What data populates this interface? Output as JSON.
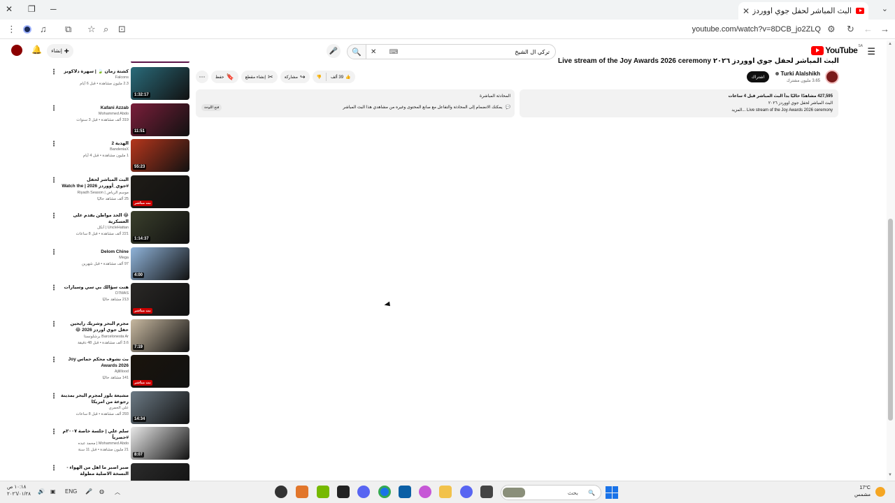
{
  "browser": {
    "tab_title": "البث المباشر لحفل جوي اووردز ٢٠٢٦",
    "url": "youtube.com/watch?v=8DCB_jo2ZLQ",
    "new_tab": "+",
    "tab_close": "✕"
  },
  "youtube": {
    "logo_word": "YouTube",
    "logo_region": "SA",
    "search_value": "تركي ال الشيخ",
    "create_label": "إنشاء"
  },
  "video": {
    "title": "البث المباشر لحفل جوي اووردز ٢٠٢٦ Live stream of the Joy Awards 2026 ceremony",
    "channel": "Turki Alalshikh",
    "subscribers": "3.65 مليون مشترك",
    "subscribe_label": "اشتراك",
    "likes": "39 ألف",
    "share_label": "مشاركة",
    "clip_label": "إنشاء مقطع",
    "save_label": "حفظ",
    "description_stats": "427,595 مشاهدًا حاليًا  بدأ البث المباشر قبل 4 ساعات",
    "description_line1": "البث المباشر لحفل جوي اووردز ٢٠٢٦",
    "description_line2": "Live stream of the Joy Awards 2026 ceremony ...المزيد",
    "chat_title": "المحادثة المباشرة",
    "chat_message": "يمكنك الانضمام إلى المحادثة والتفاعل مع صانع المحتوى وغيره من مشاهدي هذا البث المباشر",
    "chat_open": "فتح اللوحة"
  },
  "recommendations": [
    {
      "title": "كشتة زمان 🍃 | سهرة دلاكوبز",
      "channel": "Falcons",
      "views": "2.3 مليون مشاهدة • قبل 6 أيام",
      "badge": "1:32:17",
      "live": false,
      "color": "#2a6b7a"
    },
    {
      "title": "Kafani Azzab",
      "channel": "Mohammed Abdo",
      "views": "319 ألف مشاهدة • قبل 3 سنوات",
      "badge": "11:51",
      "live": false,
      "color": "#7a1e3a"
    },
    {
      "title": "الهدية 2",
      "channel": "BandeniaX",
      "views": "1 مليون مشاهدة • قبل 4 أيام",
      "badge": "55:23",
      "live": false,
      "color": "#b5361c"
    },
    {
      "title": "البث المباشر لحفل #جوي_أووردز 2026 | Watch the Live Stream of Joy ...",
      "channel": "موسم الرياض | Riyadh Season",
      "views": "25 ألف مشاهد حاليًا",
      "badge": "بث مباشر",
      "live": true,
      "color": "#1f1c17"
    },
    {
      "title": "😂 الحد مواطن يقدم على العسكرية",
      "channel": "UncleHattan | أنكل",
      "views": "221 ألف مشاهدة • قبل 8 ساعات",
      "badge": "1:14:37",
      "live": false,
      "color": "#3a3f2c"
    },
    {
      "title": "Delom Chine",
      "channel": "Mega",
      "views": "97 ألف مشاهدة • قبل شهرين",
      "badge": "4:00",
      "live": false,
      "color": "#8fb3d9"
    },
    {
      "title": "هنت سؤالك بي سي وسيارات",
      "channel": "D7MAS",
      "views": "213 مشاهد حاليًا",
      "badge": "بث مباشر",
      "live": true,
      "color": "#2a2826"
    },
    {
      "title": "مجرم البحر وشريك رايحين حفل جوي اوردز 2026 😂 متوترين",
      "channel": "Barcelonesta Ar برشلونستا",
      "views": "3.6 ألف مشاهدة • قبل 48 دقيقة",
      "badge": "7:19",
      "live": false,
      "color": "#c7b8a0"
    },
    {
      "title": "بث نشوف محكم حماس Joy Awards 2026",
      "channel": "Ajlilllood",
      "views": "141 مشاهد حاليًا",
      "badge": "بث مباشر",
      "live": true,
      "color": "#1a140c"
    },
    {
      "title": "مشيعة بلوز لمجرم البحر بمدينة رجوعة من امريكا",
      "channel": "علي الحمري",
      "views": "293 ألف مشاهدة • قبل 8 ساعات",
      "badge": "14:34",
      "live": false,
      "color": "#6c7a85"
    },
    {
      "title": "سلم علي | جلسة خاصة ٢٠٠٧م #حصرياً",
      "channel": "Mohammed Abdo | محمد عبده",
      "views": "21 مليون مشاهدة • قبل 11 سنة",
      "badge": "8:07",
      "live": false,
      "color": "#e8e8e8"
    },
    {
      "title": "صبر اصبر ما اهل من الهواء - النسخة الاصلية مطولة",
      "channel": "",
      "views": "",
      "badge": "",
      "live": false,
      "color": "#2b2b2b"
    }
  ],
  "taskbar": {
    "time": "١٠:١٨ ص",
    "date": "٢٠٢٦/٠١/٢٨",
    "lang": "ENG",
    "search_placeholder": "بحث",
    "temperature": "17°C",
    "weather": "مشمس"
  }
}
